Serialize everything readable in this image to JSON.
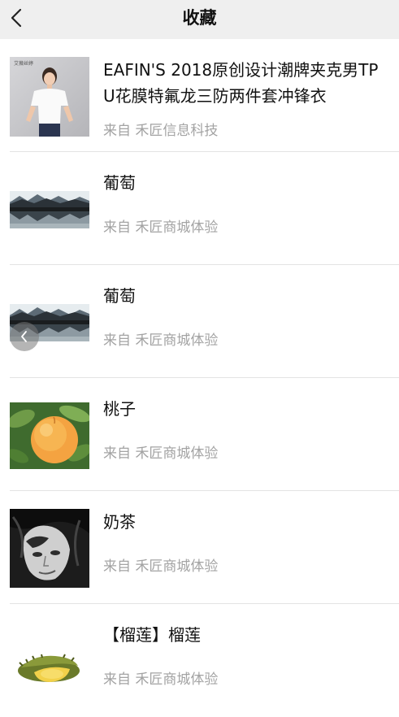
{
  "nav": {
    "title": "收藏",
    "back_icon": "chevron-left-icon"
  },
  "items": [
    {
      "title": "EAFIN'S 2018原创设计潮牌夹克男TPU花膜特氟龙三防两件套冲锋衣",
      "source": "来自 禾匠信息科技",
      "thumb": "woman-white-tshirt-photo",
      "thumb_caption": "艾薇丝婷"
    },
    {
      "title": "葡萄",
      "source": "来自 禾匠商城体验",
      "thumb": "mountain-lake-photo"
    },
    {
      "title": "葡萄",
      "source": "来自 禾匠商城体验",
      "thumb": "mountain-lake-photo"
    },
    {
      "title": "桃子",
      "source": "来自 禾匠商城体验",
      "thumb": "peach-photo"
    },
    {
      "title": "奶茶",
      "source": "来自 禾匠商城体验",
      "thumb": "bw-portrait-photo"
    },
    {
      "title": "【榴莲】榴莲",
      "source": "来自 禾匠商城体验",
      "thumb": "durian-photo"
    }
  ],
  "floating_back": {
    "icon": "chevron-left-icon"
  }
}
